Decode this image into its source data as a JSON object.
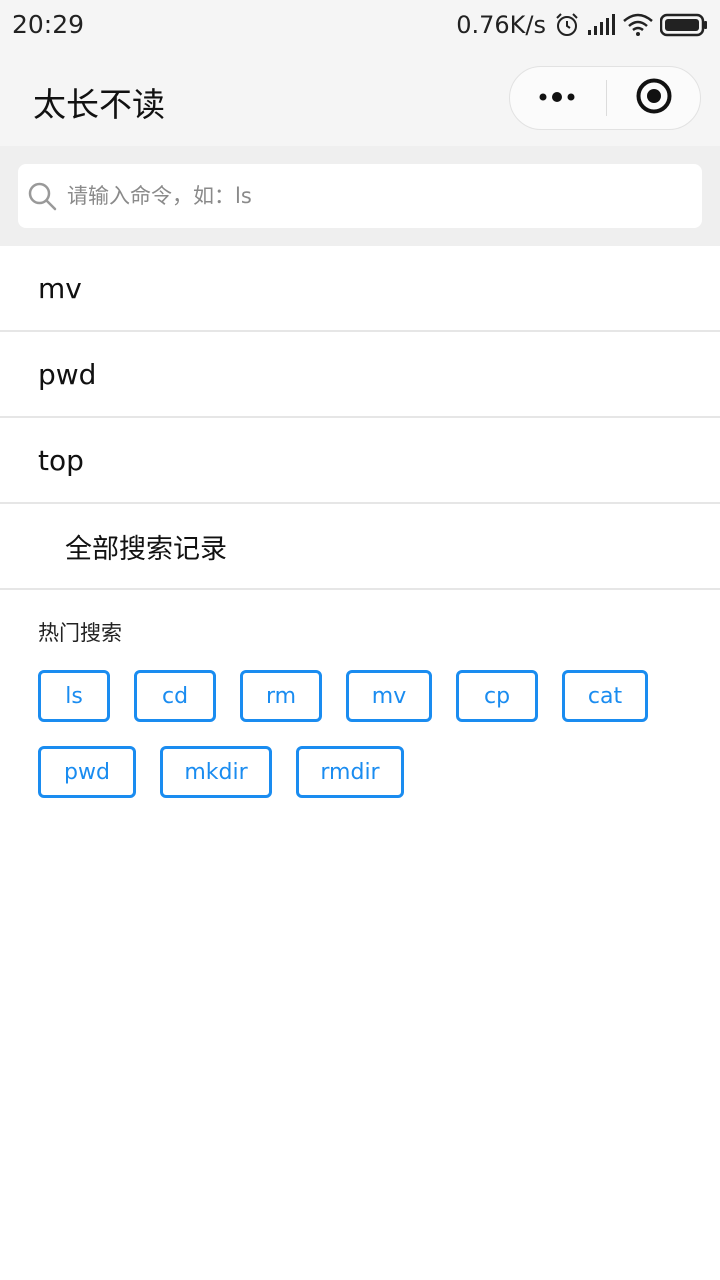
{
  "status_bar": {
    "time": "20:29",
    "net_speed": "0.76K/s",
    "icons": [
      "alarm-icon",
      "signal-icon",
      "wifi-icon",
      "battery-icon"
    ]
  },
  "nav": {
    "title": "太长不读",
    "more_icon": "more-dots-icon",
    "close_icon": "target-close-icon"
  },
  "search": {
    "placeholder": "请输入命令，如：ls",
    "value": ""
  },
  "history": {
    "items": [
      "mv",
      "pwd",
      "top"
    ],
    "all_label": "全部搜索记录"
  },
  "hot": {
    "title": "热门搜索",
    "tags": [
      "ls",
      "cd",
      "rm",
      "mv",
      "cp",
      "cat",
      "pwd",
      "mkdir",
      "rmdir"
    ]
  },
  "colors": {
    "accent": "#1a8cf0",
    "nav_bg": "#f5f5f5",
    "search_bg": "#efefef"
  }
}
